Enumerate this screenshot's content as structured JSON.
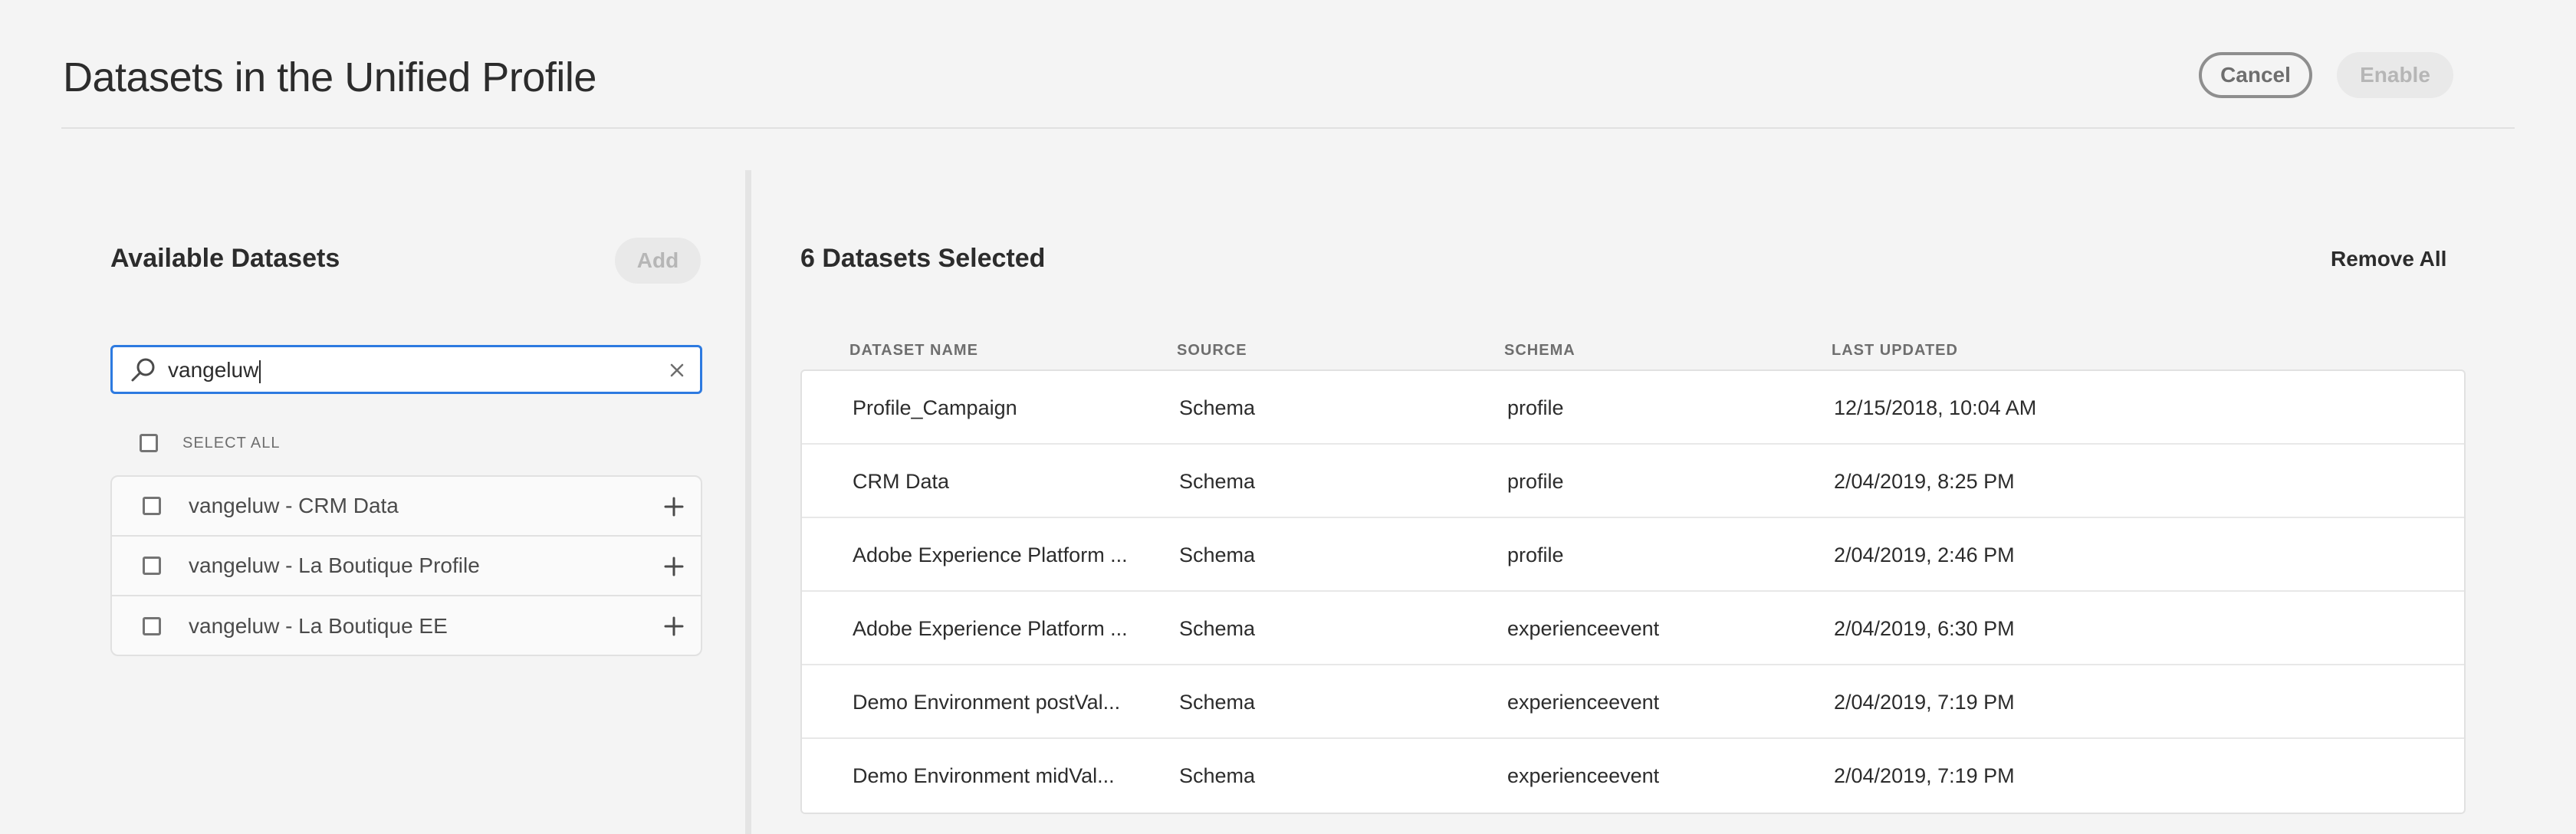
{
  "header": {
    "title": "Datasets in the Unified Profile",
    "cancel_label": "Cancel",
    "enable_label": "Enable"
  },
  "available": {
    "title": "Available Datasets",
    "add_label": "Add",
    "search_value": "vangeluw",
    "select_all_label": "SELECT ALL",
    "items": [
      {
        "label": "vangeluw - CRM Data"
      },
      {
        "label": "vangeluw - La Boutique Profile"
      },
      {
        "label": "vangeluw - La Boutique EE"
      }
    ]
  },
  "selected": {
    "title": "6 Datasets Selected",
    "remove_all_label": "Remove All",
    "columns": [
      "DATASET NAME",
      "SOURCE",
      "SCHEMA",
      "LAST UPDATED"
    ],
    "rows": [
      {
        "name": "Profile_Campaign",
        "source": "Schema",
        "schema": "profile",
        "updated": "12/15/2018, 10:04 AM"
      },
      {
        "name": "CRM Data",
        "source": "Schema",
        "schema": "profile",
        "updated": "2/04/2019, 8:25 PM"
      },
      {
        "name": "Adobe Experience Platform ...",
        "source": "Schema",
        "schema": "profile",
        "updated": "2/04/2019, 2:46 PM"
      },
      {
        "name": "Adobe Experience Platform ...",
        "source": "Schema",
        "schema": "experienceevent",
        "updated": "2/04/2019, 6:30 PM"
      },
      {
        "name": "Demo Environment postVal...",
        "source": "Schema",
        "schema": "experienceevent",
        "updated": "2/04/2019, 7:19 PM"
      },
      {
        "name": "Demo Environment midVal...",
        "source": "Schema",
        "schema": "experienceevent",
        "updated": "2/04/2019, 7:19 PM"
      }
    ]
  },
  "colors": {
    "accent_focus": "#2d7ae0",
    "background": "#f4f4f4",
    "disabled_button": "#e9e9e9"
  }
}
